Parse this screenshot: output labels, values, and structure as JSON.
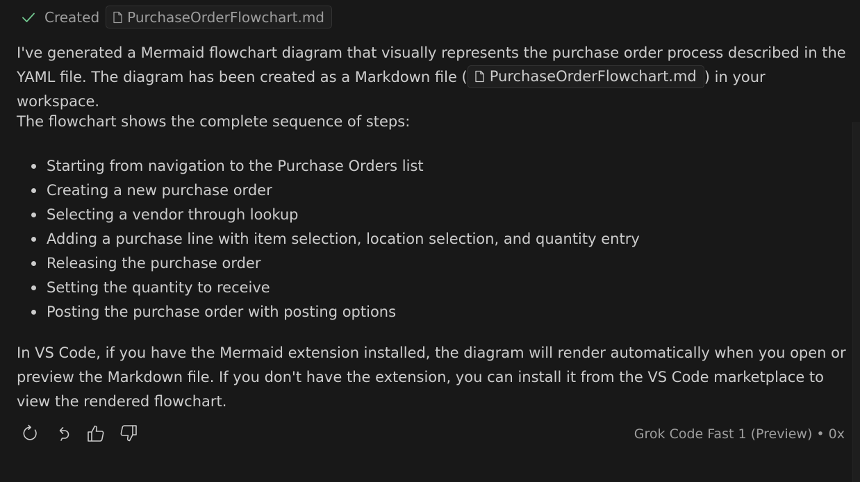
{
  "created": {
    "label": "Created",
    "filename": "PurchaseOrderFlowchart.md",
    "icons": {
      "status": "check-icon",
      "file": "file-icon"
    }
  },
  "message": {
    "intro_before": "I've generated a Mermaid flowchart diagram that visually represents the purchase order process described in the YAML file. The diagram has been created as a Markdown file (",
    "intro_file": "PurchaseOrderFlowchart.md",
    "intro_after": ") in your workspace.",
    "steps_intro": "The flowchart shows the complete sequence of steps:",
    "steps": [
      "Starting from navigation to the Purchase Orders list",
      "Creating a new purchase order",
      "Selecting a vendor through lookup",
      "Adding a purchase line with item selection, location selection, and quantity entry",
      "Releasing the purchase order",
      "Setting the quantity to receive",
      "Posting the purchase order with posting options"
    ],
    "closing": "In VS Code, if you have the Mermaid extension installed, the diagram will render automatically when you open or preview the Markdown file. If you don't have the extension, you can install it from the VS Code marketplace to view the rendered flowchart."
  },
  "actions": {
    "icons": [
      "retry-icon",
      "undo-icon",
      "thumbs-up-icon",
      "thumbs-down-icon"
    ]
  },
  "model_info": "Grok Code Fast 1 (Preview) • 0x",
  "colors": {
    "background": "#181818",
    "text": "#cccccc",
    "muted_text": "#9d9d9d",
    "check": "#73c991",
    "chip_border": "#333333"
  }
}
